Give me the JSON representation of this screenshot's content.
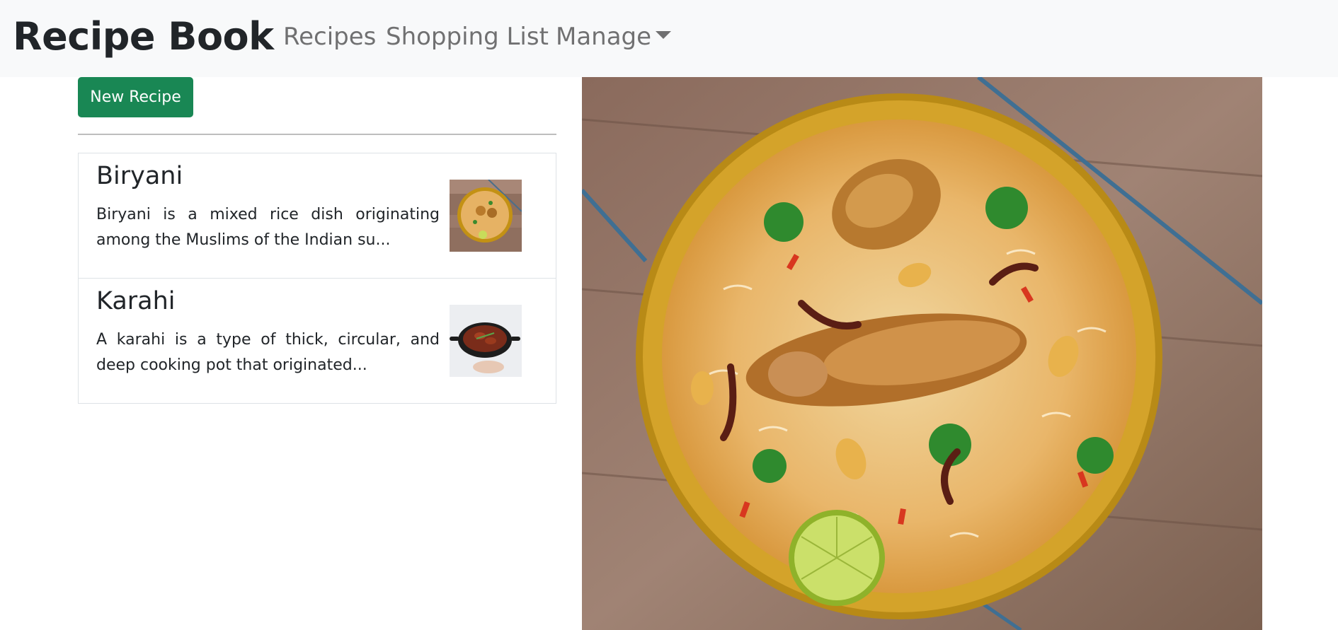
{
  "navbar": {
    "brand": "Recipe Book",
    "links": [
      "Recipes",
      "Shopping List"
    ],
    "dropdown_label": "Manage"
  },
  "actions": {
    "new_recipe_label": "New Recipe",
    "button_color": "#198754"
  },
  "recipes": [
    {
      "name": "Biryani",
      "description": "Biryani is a mixed rice dish originating among the Muslims of the Indian su...",
      "image_icon": "biryani-plate-thumbnail"
    },
    {
      "name": "Karahi",
      "description": "A karahi is a type of thick, circular, and deep cooking pot that originated...",
      "image_icon": "karahi-pot-thumbnail"
    }
  ],
  "detail": {
    "image_icon": "biryani-plate-photo"
  }
}
